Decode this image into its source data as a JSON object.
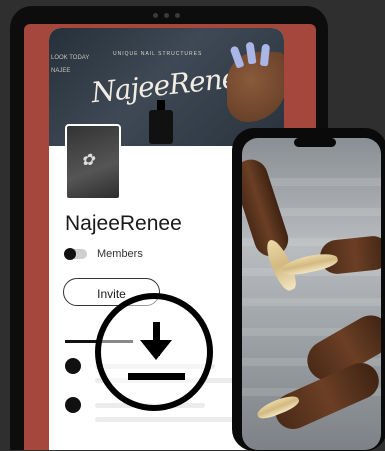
{
  "banner": {
    "script_title": "NajeeRenee",
    "small_text": "UNIQUE NAIL STRUCTURES",
    "side_text": "LOOK TODAY NAJEE"
  },
  "profile": {
    "group_name": "NajeeRenee",
    "members_label": "Members",
    "invite_label": "Invite"
  },
  "icons": {
    "download": "download-icon",
    "home": "home-icon",
    "explore": "compass-icon",
    "chat": "chat-icon"
  },
  "colors": {
    "accent": "#1f6fe0",
    "tablet_background": "#a6473e",
    "notification": "#e3463b"
  }
}
